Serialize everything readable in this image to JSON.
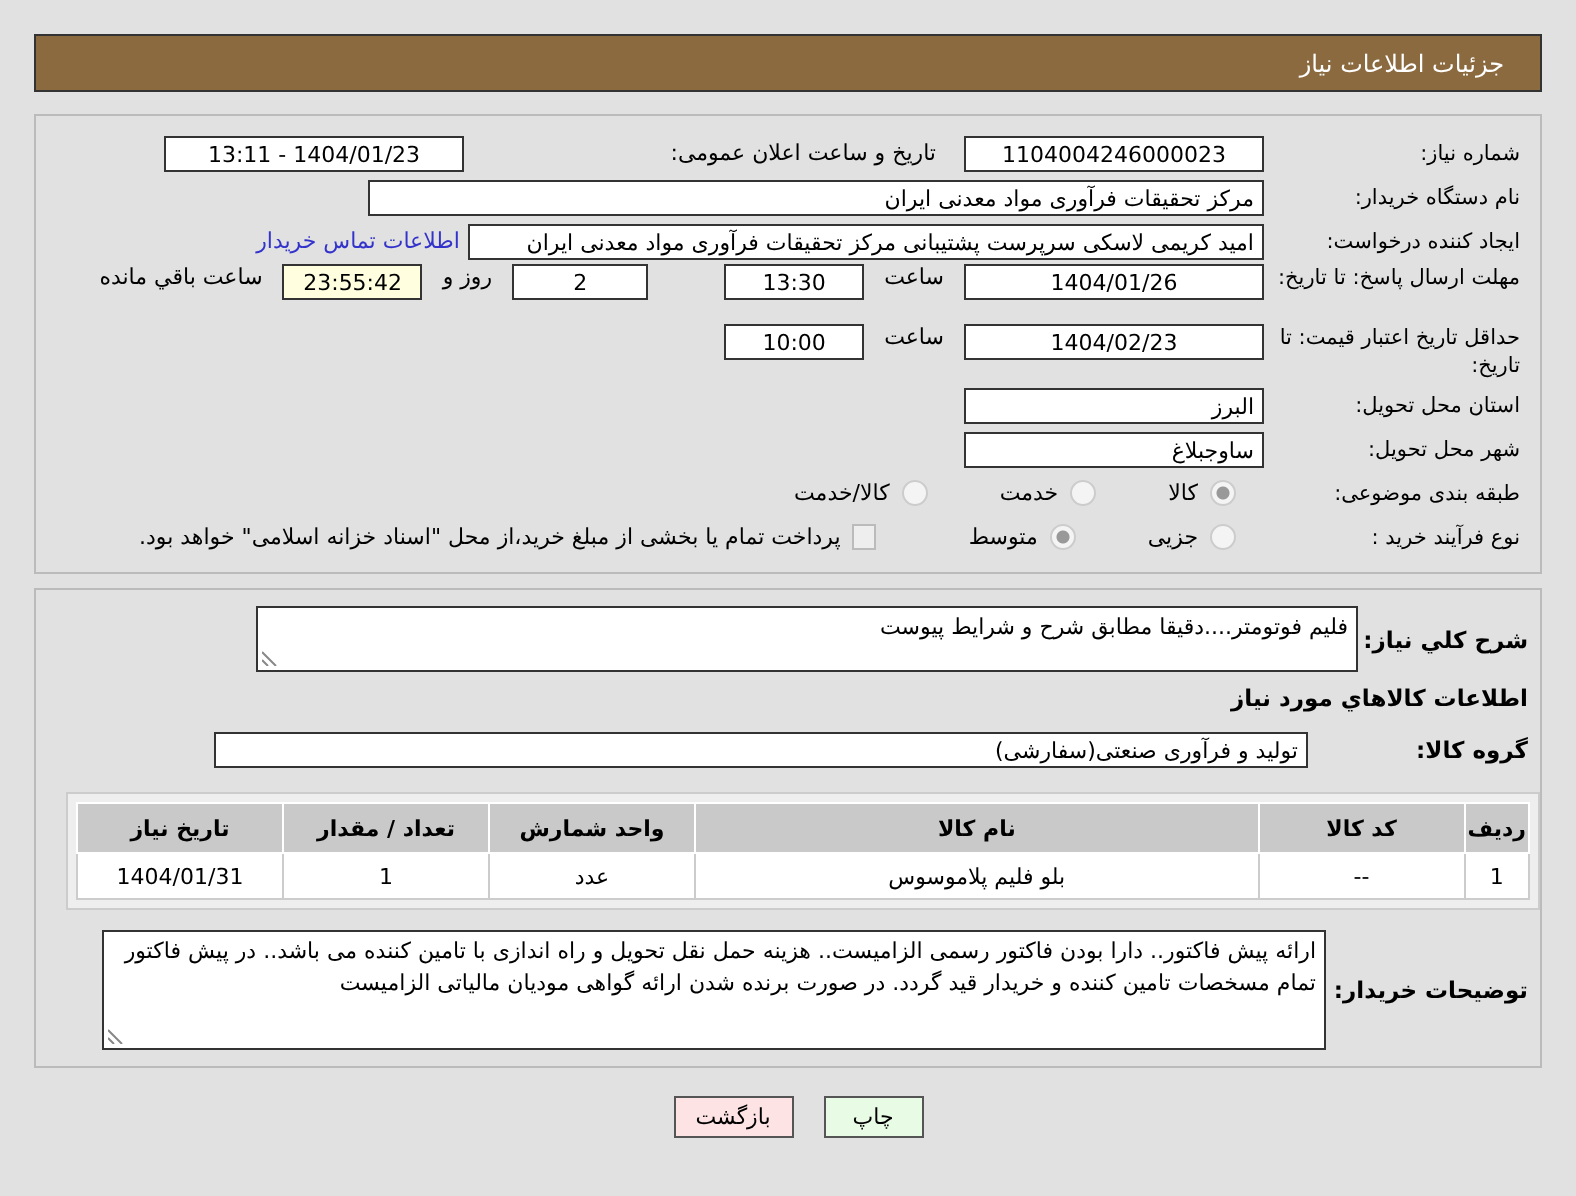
{
  "header": {
    "title": "جزئیات اطلاعات نیاز"
  },
  "need_number": {
    "label": "شماره نیاز:",
    "value": "1104004246000023"
  },
  "announce": {
    "label": "تاریخ و ساعت اعلان عمومی:",
    "value": "1404/01/23 - 13:11"
  },
  "buyer_org": {
    "label": "نام دستگاه خریدار:",
    "value": "مرکز تحقیقات فرآوری مواد معدنی ایران"
  },
  "requester": {
    "label": "ایجاد کننده درخواست:",
    "value": "امید کریمی لاسکی سرپرست پشتیبانی مرکز تحقیقات فرآوری مواد معدنی ایران",
    "link": "اطلاعات تماس خریدار"
  },
  "reply_deadline": {
    "label": "مهلت ارسال پاسخ: تا تاریخ:",
    "date": "1404/01/26",
    "time_label": "ساعت",
    "time": "13:30",
    "days": "2",
    "days_label": "روز و",
    "remaining": "23:55:42",
    "remaining_label": "ساعت باقي مانده"
  },
  "price_validity": {
    "label": "حداقل تاریخ اعتبار قیمت: تا تاریخ:",
    "date": "1404/02/23",
    "time_label": "ساعت",
    "time": "10:00"
  },
  "province": {
    "label": "استان محل تحویل:",
    "value": "البرز"
  },
  "city": {
    "label": "شهر محل تحویل:",
    "value": "ساوجبلاغ"
  },
  "category": {
    "label": "طبقه بندی موضوعی:",
    "options": [
      {
        "label": "کالا",
        "selected": true
      },
      {
        "label": "خدمت",
        "selected": false
      },
      {
        "label": "کالا/خدمت",
        "selected": false
      }
    ]
  },
  "process": {
    "label": "نوع فرآیند خرید :",
    "options": [
      {
        "label": "جزیی",
        "selected": false
      },
      {
        "label": "متوسط",
        "selected": true
      }
    ],
    "treasury": {
      "checked": false,
      "text": "پرداخت تمام یا بخشی از مبلغ خرید،از محل \"اسناد خزانه اسلامی\" خواهد بود."
    }
  },
  "description": {
    "label": "شرح کلي نیاز:",
    "value": "فلیم فوتومتر....دقیقا مطابق شرح و شرایط پیوست"
  },
  "goods_heading": "اطلاعات کالاهاي مورد نیاز",
  "goods_group": {
    "label": "گروه کالا:",
    "value": "تولید و فرآوری صنعتی(سفارشی)"
  },
  "table": {
    "columns": [
      "ردیف",
      "کد کالا",
      "نام کالا",
      "واحد شمارش",
      "تعداد / مقدار",
      "تاریخ نیاز"
    ],
    "rows": [
      [
        "1",
        "--",
        "بلو فلیم پلاموسوس",
        "عدد",
        "1",
        "1404/01/31"
      ]
    ]
  },
  "buyer_notes": {
    "label": "توضیحات خریدار:",
    "value": "ارائه پیش فاکتور.. دارا بودن فاکتور رسمی الزامیست.. هزینه حمل نقل تحویل و راه اندازی با تامین کننده می باشد.. در پیش فاکتور تمام  مسخصات تامین کننده و خریدار قید گردد. در صورت برنده شدن ارائه گواهی مودیان مالیاتی الزامیست"
  },
  "buttons": [
    {
      "label": "چاپ",
      "kind": "print"
    },
    {
      "label": "بازگشت",
      "kind": "back"
    }
  ]
}
